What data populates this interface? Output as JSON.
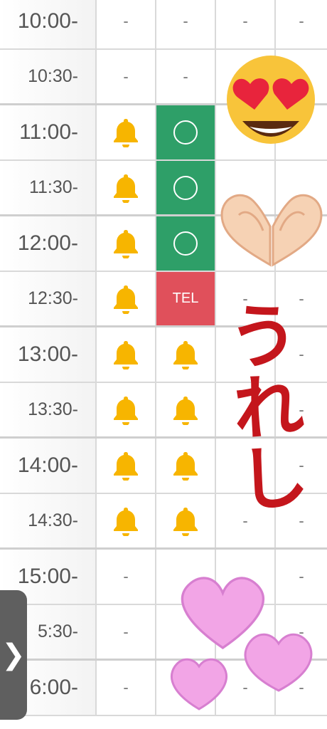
{
  "time_slots": [
    {
      "time": "10:00-",
      "cols": [
        "-",
        "-",
        "-",
        "-"
      ]
    },
    {
      "time": "10:30-",
      "cols": [
        "-",
        "-",
        "",
        ""
      ]
    },
    {
      "time": "11:00-",
      "cols": [
        "bell",
        "open",
        "",
        ""
      ]
    },
    {
      "time": "11:30-",
      "cols": [
        "bell",
        "open",
        "",
        ""
      ]
    },
    {
      "time": "12:00-",
      "cols": [
        "bell",
        "open",
        "",
        ""
      ]
    },
    {
      "time": "12:30-",
      "cols": [
        "bell",
        "TEL",
        "-",
        "-"
      ]
    },
    {
      "time": "13:00-",
      "cols": [
        "bell",
        "bell",
        "",
        "-"
      ]
    },
    {
      "time": "13:30-",
      "cols": [
        "bell",
        "bell",
        "",
        "-"
      ]
    },
    {
      "time": "14:00-",
      "cols": [
        "bell",
        "bell",
        "",
        "-"
      ]
    },
    {
      "time": "14:30-",
      "cols": [
        "bell",
        "bell",
        "-",
        "-"
      ]
    },
    {
      "time": "15:00-",
      "cols": [
        "-",
        "",
        "",
        "-"
      ]
    },
    {
      "time": "5:30-",
      "cols": [
        "-",
        "",
        "",
        "-"
      ]
    },
    {
      "time": "6:00-",
      "cols": [
        "-",
        "",
        "-",
        "-"
      ]
    }
  ],
  "legend": {
    "dash": "-",
    "tel": "TEL"
  },
  "stickers": {
    "text": "うれし",
    "heart_eyes": "heart-eyes-emoji",
    "heart_hands": "heart-hands-emoji",
    "pink_hearts": "pink-hearts-doodle"
  },
  "side_tab": {
    "label": "❯"
  },
  "colors": {
    "open": "#2e9f68",
    "tel": "#e0505b",
    "bell": "#f7b500",
    "sticker_text": "#c4161c",
    "hearts": "#f2a5e6"
  }
}
